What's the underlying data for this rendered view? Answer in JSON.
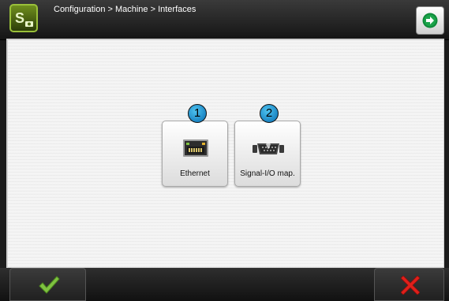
{
  "header": {
    "breadcrumb": "Configuration > Machine > Interfaces",
    "logo_icon": "app-logo-icon",
    "next_icon": "arrow-right-icon"
  },
  "tiles": [
    {
      "badge": "1",
      "label": "Ethernet",
      "icon": "ethernet-port-icon"
    },
    {
      "badge": "2",
      "label": "Signal-I/O map.",
      "icon": "signal-io-connector-icon"
    }
  ],
  "footer": {
    "ok_icon": "checkmark-icon",
    "cancel_icon": "cross-icon"
  },
  "colors": {
    "accent_green": "#7fc241",
    "cancel_red": "#e0201b",
    "badge_blue": "#2a9ad6"
  }
}
